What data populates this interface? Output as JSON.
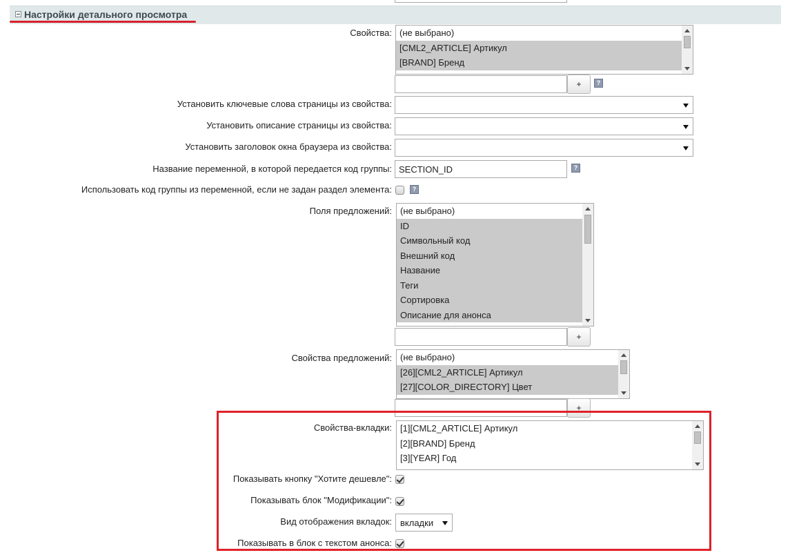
{
  "section": {
    "title": "Настройки детального просмотра"
  },
  "properties": {
    "label": "Свойства:",
    "items": [
      "(не выбрано)",
      "[CML2_ARTICLE] Артикул",
      "[BRAND] Бренд"
    ],
    "add_value": "",
    "add_label": "+"
  },
  "help_glyph": "?",
  "keywords": {
    "label": "Установить ключевые слова страницы из свойства:",
    "value": ""
  },
  "description": {
    "label": "Установить описание страницы из свойства:",
    "value": ""
  },
  "browser_title": {
    "label": "Установить заголовок окна браузера из свойства:",
    "value": ""
  },
  "section_var": {
    "label": "Название переменной, в которой передается код группы:",
    "value": "SECTION_ID"
  },
  "use_section_code": {
    "label": "Использовать код группы из переменной, если не задан раздел элемента:",
    "checked": false
  },
  "offer_fields": {
    "label": "Поля предложений:",
    "items": [
      "(не выбрано)",
      "ID",
      "Символьный код",
      "Внешний код",
      "Название",
      "Теги",
      "Сортировка",
      "Описание для анонса"
    ],
    "add_value": "",
    "add_label": "+"
  },
  "offer_properties": {
    "label": "Свойства предложений:",
    "items": [
      "(не выбрано)",
      "[26][CML2_ARTICLE] Артикул",
      "[27][COLOR_DIRECTORY] Цвет"
    ],
    "add_value": "",
    "add_label": "+"
  },
  "tab_properties": {
    "label": "Свойства-вкладки:",
    "items": [
      "[1][CML2_ARTICLE] Артикул",
      "[2][BRAND] Бренд",
      "[3][YEAR] Год"
    ]
  },
  "show_cheaper": {
    "label": "Показывать кнопку \"Хотите дешевле\":",
    "checked": true
  },
  "show_modifications": {
    "label": "Показывать блок \"Модификации\":",
    "checked": true
  },
  "tabs_view": {
    "label": "Вид отображения вкладок:",
    "value": "вкладки"
  },
  "show_in_preview": {
    "label": "Показывать в блок с текстом анонса:",
    "checked": true
  },
  "colors": {
    "header_bg": "#e0e8ea",
    "highlight_red": "#e0202a",
    "selected_item": "#cacaca"
  }
}
